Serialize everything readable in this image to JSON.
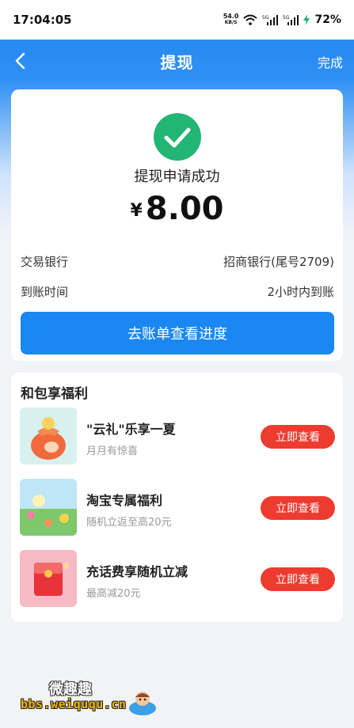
{
  "status_bar": {
    "time": "17:04:05",
    "net_speed": "54.0",
    "net_unit": "KB/S",
    "battery": "72%"
  },
  "nav": {
    "title": "提现",
    "done_label": "完成"
  },
  "result": {
    "message": "提现申请成功",
    "currency": "¥",
    "amount": "8.00",
    "rows": [
      {
        "label": "交易银行",
        "value": "招商银行(尾号2709)"
      },
      {
        "label": "到账时间",
        "value": "2小时内到账"
      }
    ],
    "button_label": "去账单查看进度"
  },
  "perks": {
    "title": "和包享福利",
    "items": [
      {
        "title": "\"云礼\"乐享一夏",
        "subtitle": "月月有惊喜",
        "button": "立即查看"
      },
      {
        "title": "淘宝专属福利",
        "subtitle": "随机立返至高20元",
        "button": "立即查看"
      },
      {
        "title": "充话费享随机立减",
        "subtitle": "最高减20元",
        "button": "立即查看"
      }
    ]
  },
  "watermark": {
    "name": "微趣趣",
    "url": "bbs.weiququ.cn"
  },
  "colors": {
    "primary": "#1a87f2",
    "success": "#22b573",
    "cta_red": "#ee3b2f"
  }
}
